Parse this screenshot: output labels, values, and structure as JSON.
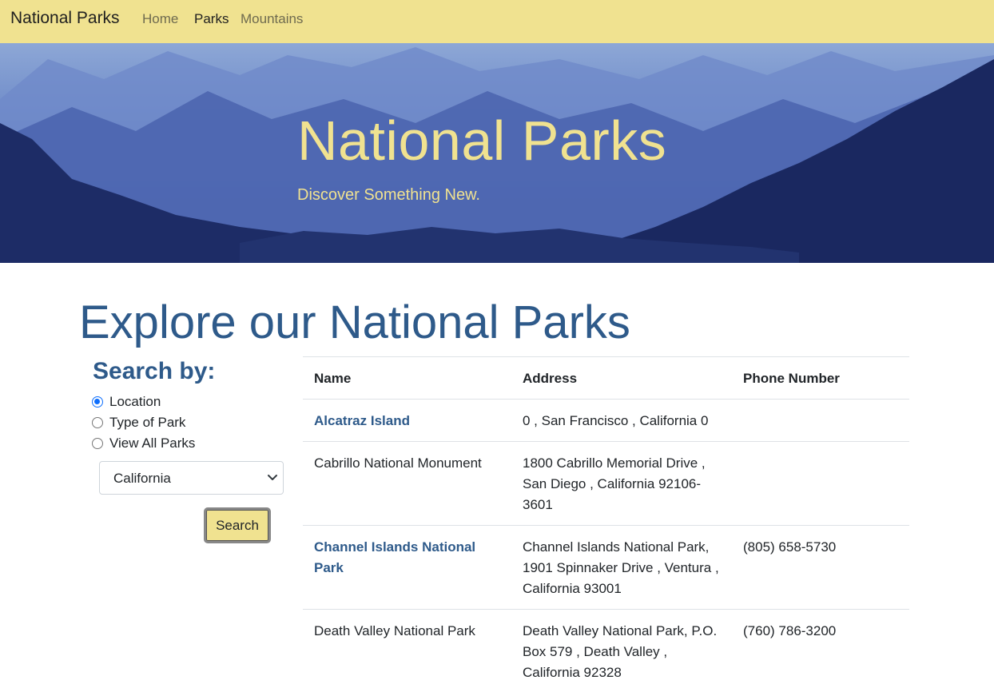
{
  "navbar": {
    "brand": "National Parks",
    "links": [
      {
        "label": "Home",
        "active": false
      },
      {
        "label": "Parks",
        "active": true
      },
      {
        "label": "Mountains",
        "active": false
      }
    ]
  },
  "hero": {
    "title": "National Parks",
    "subtitle": "Discover Something New."
  },
  "main": {
    "title": "Explore our National Parks"
  },
  "search": {
    "heading": "Search by:",
    "options": [
      {
        "label": "Location",
        "checked": true
      },
      {
        "label": "Type of Park",
        "checked": false
      },
      {
        "label": "View All Parks",
        "checked": false
      }
    ],
    "selected_state": "California",
    "button_label": "Search"
  },
  "table": {
    "headers": [
      "Name",
      "Address",
      "Phone Number"
    ],
    "rows": [
      {
        "name": "Alcatraz Island",
        "name_is_link": true,
        "address": "0 , San Francisco , California 0",
        "phone": ""
      },
      {
        "name": "Cabrillo National Monument",
        "name_is_link": false,
        "address": "1800 Cabrillo Memorial Drive , San Diego , California 92106-3601",
        "phone": ""
      },
      {
        "name": "Channel Islands National Park",
        "name_is_link": true,
        "address": "Channel Islands National Park, 1901 Spinnaker Drive , Ventura , California 93001",
        "phone": "(805) 658-5730"
      },
      {
        "name": "Death Valley National Park",
        "name_is_link": false,
        "address": "Death Valley National Park, P.O. Box 579 , Death Valley , California 92328",
        "phone": "(760) 786-3200"
      }
    ]
  },
  "colors": {
    "navbar_bg": "#f0e290",
    "accent_text": "#2e5a8a",
    "hero_text": "#f0e290",
    "radio_checked": "#0d6efd"
  }
}
